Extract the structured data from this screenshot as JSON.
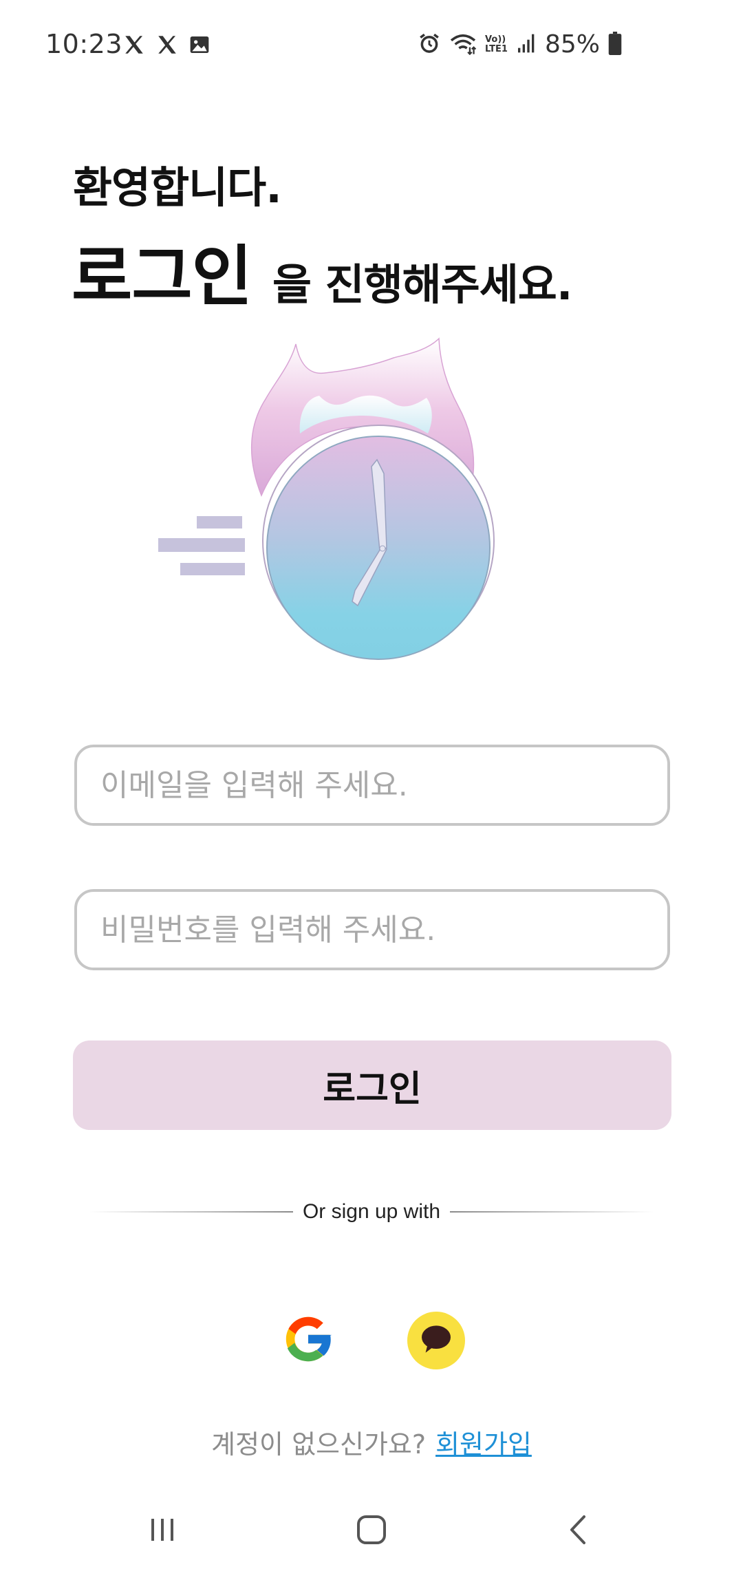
{
  "status_bar": {
    "time": "10:23",
    "left_icons": [
      "x-logo-icon",
      "x-logo-icon",
      "image-icon"
    ],
    "right_icons": [
      "alarm-icon",
      "wifi-icon",
      "volte-icon",
      "signal-icon",
      "battery-icon"
    ],
    "volte_line1": "Vo))",
    "volte_line2": "LTE1",
    "battery": "85%"
  },
  "header": {
    "welcome": "환영합니다.",
    "login_word": "로그인",
    "login_rest": "을 진행해주세요."
  },
  "illustration": {
    "icon": "flaming-clock-illustration"
  },
  "form": {
    "email_placeholder": "이메일을 입력해 주세요.",
    "email_value": "",
    "password_placeholder": "비밀번호를 입력해 주세요.",
    "password_value": "",
    "login_button": "로그인"
  },
  "divider": {
    "text": "Or sign up with"
  },
  "social": {
    "google_icon": "google-icon",
    "kakao_icon": "kakao-talk-icon",
    "kakao_color": "#f9e040"
  },
  "signup": {
    "question": "계정이 없으신가요?",
    "link": "회원가입"
  },
  "nav_bar": {
    "items": [
      "recent-apps-icon",
      "home-icon",
      "back-icon"
    ]
  },
  "colors": {
    "login_button_bg": "#ead7e5",
    "field_border": "#c6c6c6",
    "link": "#1e90d6",
    "placeholder": "#a8a8a8"
  }
}
